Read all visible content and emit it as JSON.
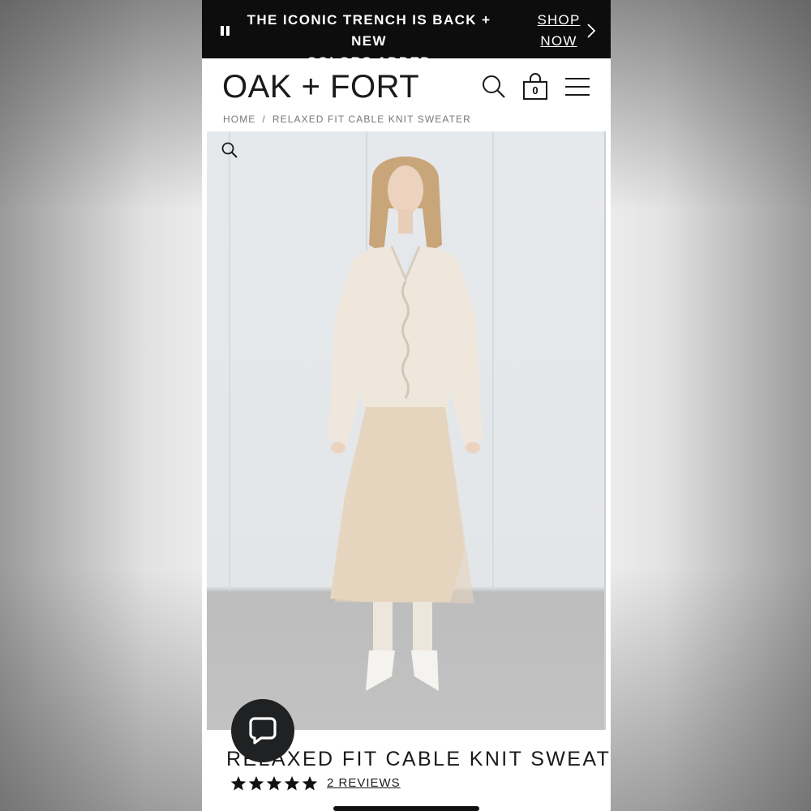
{
  "promo": {
    "line1": "THE ICONIC TRENCH IS BACK + NEW",
    "line2": "COLORS ADDED",
    "shop_now_line1": "SHOP",
    "shop_now_line2": "NOW",
    "pause_icon": "pause-icon",
    "chevron_icon": "chevron-right-icon"
  },
  "header": {
    "logo": "OAK + FORT",
    "search_icon": "search-icon",
    "bag_icon": "shopping-bag-icon",
    "bag_count": "0",
    "menu_icon": "hamburger-menu-icon"
  },
  "breadcrumb": {
    "home": "HOME",
    "separator": "/",
    "current": "RELAXED FIT CABLE KNIT SWEATER"
  },
  "product": {
    "zoom_icon": "zoom-icon",
    "title": "RELAXED FIT CABLE KNIT SWEATER",
    "rating": 5,
    "rating_max": 5,
    "reviews_label": "2 REVIEWS"
  },
  "chat": {
    "icon": "chat-bubble-icon"
  },
  "colors": {
    "banner_bg": "#0d0d0d",
    "text": "#1a1a1a",
    "chat_bg": "#1f2123"
  }
}
